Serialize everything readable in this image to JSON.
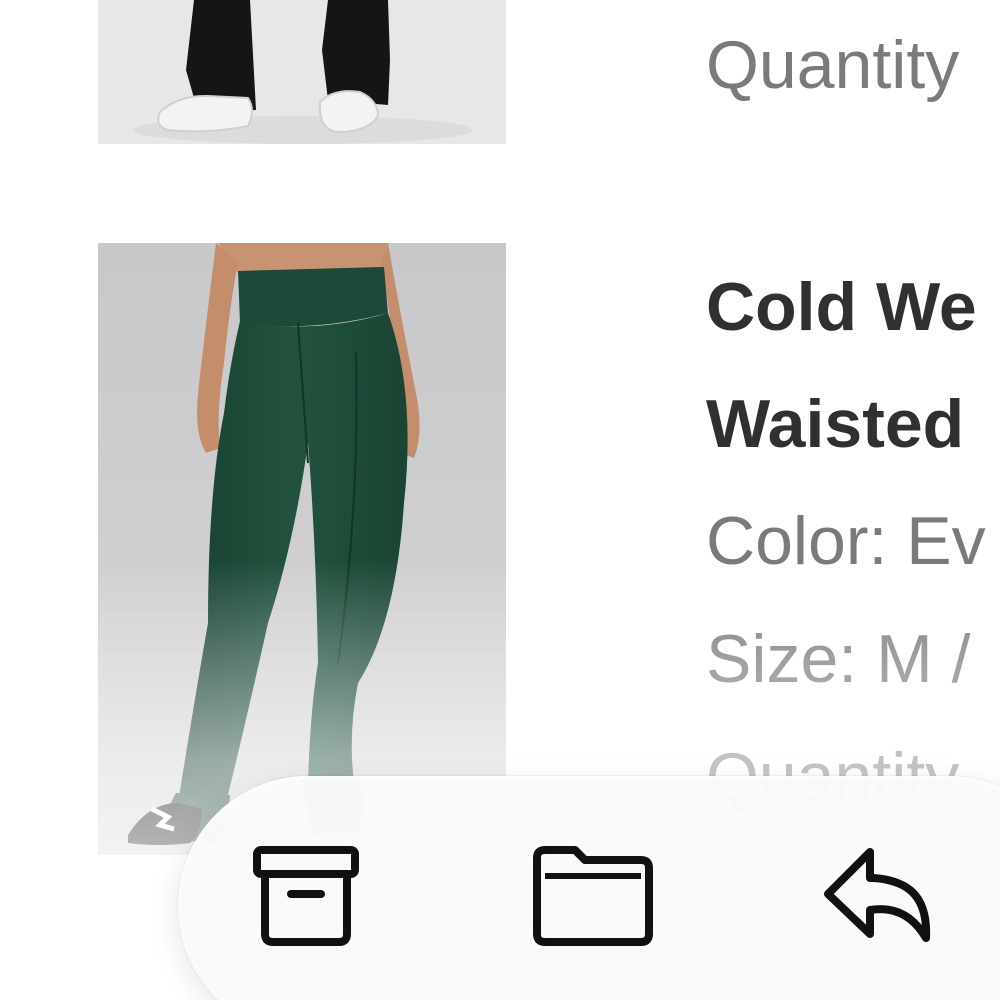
{
  "product_list": {
    "items": [
      {
        "image_desc": "black-flare-pants",
        "quantity_text": "Quantity"
      },
      {
        "image_desc": "green-flare-leggings",
        "title_line1": "Cold We",
        "title_line2": "Waisted",
        "color_text": "Color: Ev",
        "size_text": "Size: M /",
        "quantity_text": "Quantity"
      }
    ]
  },
  "toolbar": {
    "buttons": [
      {
        "icon": "archive-box-icon"
      },
      {
        "icon": "folder-icon"
      },
      {
        "icon": "reply-arrow-icon"
      }
    ]
  },
  "colors": {
    "product_green": "#1f4f3c",
    "title_text": "#303030",
    "secondary_text": "#7a7a7a",
    "icon_stroke": "#111111"
  }
}
